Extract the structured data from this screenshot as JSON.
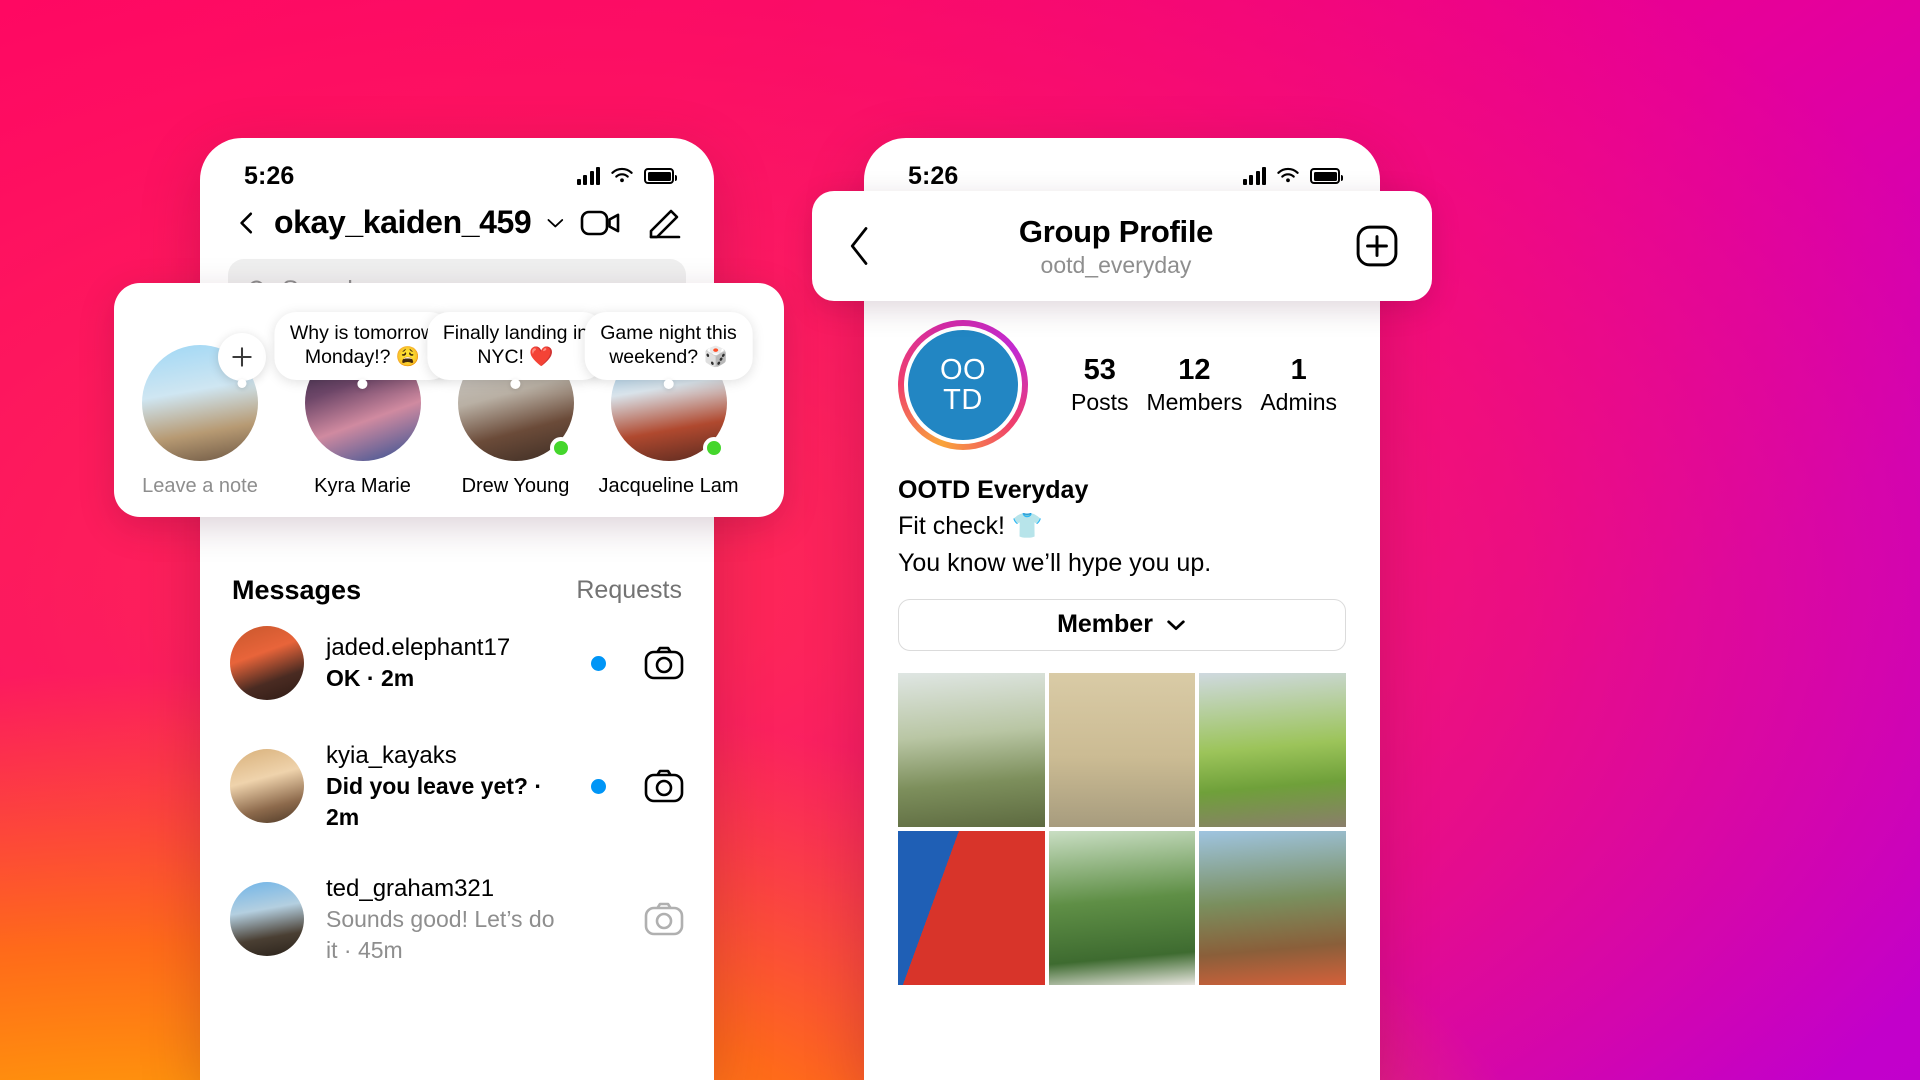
{
  "background": {
    "colors": [
      "#ff0066",
      "#cc00bf",
      "#ff9a0a",
      "#ff2b52"
    ]
  },
  "left_phone": {
    "status": {
      "time": "5:26",
      "signal_icon": "signal-bars-icon",
      "wifi_icon": "wifi-icon",
      "battery_icon": "battery-icon"
    },
    "header": {
      "back_icon": "chevron-left-icon",
      "username": "okay_kaiden_459",
      "dropdown_icon": "chevron-down-icon",
      "video_icon": "video-camera-icon",
      "compose_icon": "compose-pencil-icon"
    },
    "search": {
      "placeholder": "Search",
      "icon": "search-icon"
    },
    "notes": [
      {
        "name": "Leave a note",
        "muted": true,
        "bubble": null,
        "badge": "plus-icon",
        "online": false
      },
      {
        "name": "Kyra Marie",
        "muted": false,
        "bubble": "Why is tomorrow\nMonday!? 😩",
        "badge": null,
        "online": false
      },
      {
        "name": "Drew Young",
        "muted": false,
        "bubble": "Finally landing in\nNYC! ❤️",
        "badge": null,
        "online": true
      },
      {
        "name": "Jacqueline Lam",
        "muted": false,
        "bubble": "Game night this\nweekend? 🎲",
        "badge": null,
        "online": true
      }
    ],
    "messages_section": {
      "title": "Messages",
      "requests_label": "Requests"
    },
    "messages": [
      {
        "user": "jaded.elephant17",
        "preview": "OK · 2m",
        "unread": true,
        "camera_icon": "camera-icon",
        "camera_active": true
      },
      {
        "user": "kyia_kayaks",
        "preview": "Did you leave yet? · 2m",
        "unread": true,
        "camera_icon": "camera-icon",
        "camera_active": true
      },
      {
        "user": "ted_graham321",
        "preview": "Sounds good! Let’s do it · 45m",
        "unread": false,
        "camera_icon": "camera-icon",
        "camera_active": false
      }
    ]
  },
  "right_phone": {
    "status": {
      "time": "5:26",
      "signal_icon": "signal-bars-icon",
      "wifi_icon": "wifi-icon",
      "battery_icon": "battery-icon"
    },
    "header": {
      "back_icon": "chevron-left-icon",
      "title": "Group Profile",
      "subtitle": "ootd_everyday",
      "add_icon": "plus-square-icon"
    },
    "profile": {
      "avatar_initials_line1": "OO",
      "avatar_initials_line2": "TD",
      "avatar_color": "#2286c3",
      "stats": [
        {
          "value": "53",
          "label": "Posts"
        },
        {
          "value": "12",
          "label": "Members"
        },
        {
          "value": "1",
          "label": "Admins"
        }
      ],
      "display_name": "OOTD Everyday",
      "bio_line1": "Fit check! 👕",
      "bio_line2": "You know we’ll hype you up.",
      "action_button": {
        "label": "Member",
        "icon": "chevron-down-icon"
      }
    },
    "grid_tiles": [
      {
        "alt": "person-in-olive-outfit-outdoors"
      },
      {
        "alt": "person-in-long-coat-by-wall"
      },
      {
        "alt": "person-sitting-on-green-jeep"
      },
      {
        "alt": "couple-against-red-and-blue-wall"
      },
      {
        "alt": "person-in-white-jacket-by-ivy"
      },
      {
        "alt": "person-in-plaid-shirt-outdoors"
      }
    ]
  }
}
